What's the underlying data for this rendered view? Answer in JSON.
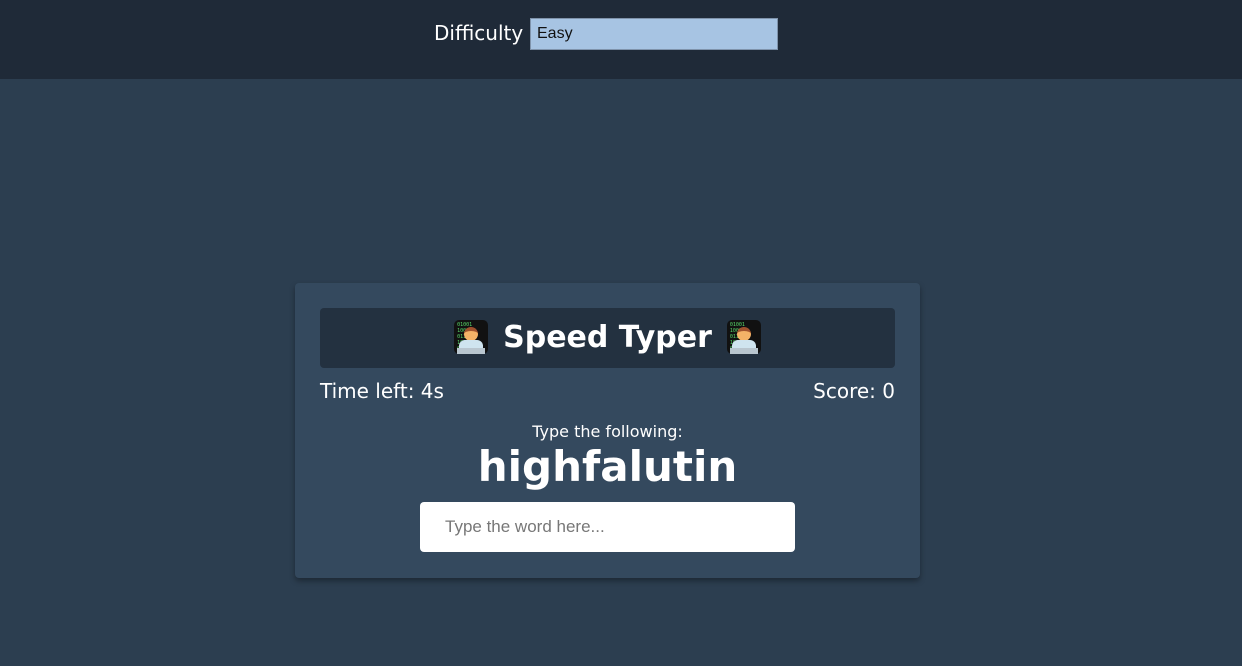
{
  "header": {
    "difficulty_label": "Difficulty",
    "difficulty_value": "Easy"
  },
  "game": {
    "title": "Speed Typer",
    "title_icon": "technologist-emoji-icon",
    "time_left": "Time left: 4s",
    "score": "Score: 0",
    "prompt": "Type the following:",
    "word": "highfalutin",
    "input_placeholder": "Type the word here...",
    "input_value": ""
  },
  "colors": {
    "background": "#2c3e50",
    "header_background": "#1f2a38",
    "card_background": "#34495e",
    "title_bar_background": "#233140",
    "select_background": "#a7c4e3",
    "text": "#ffffff"
  }
}
